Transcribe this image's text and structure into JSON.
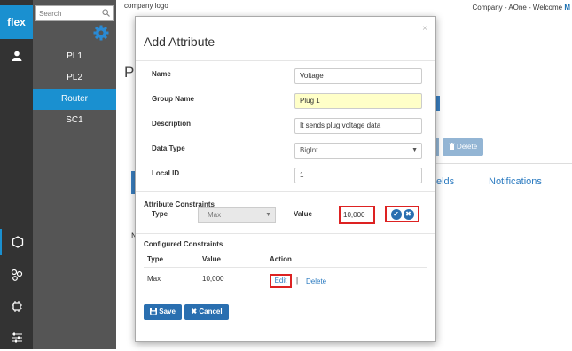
{
  "rail": {
    "logo": "flex"
  },
  "sidebar": {
    "search_placeholder": "Search",
    "items": [
      {
        "label": "PL1"
      },
      {
        "label": "PL2"
      },
      {
        "label": "Router"
      },
      {
        "label": "SC1"
      }
    ]
  },
  "header": {
    "company_logo": "company logo",
    "welcome_text": "Company - AOne - Welcome ",
    "welcome_user_initial": "M"
  },
  "background": {
    "page_title_initial": "P",
    "delete_label": "Delete",
    "tab_fields_partial": "elds",
    "tab_notifications": "Notifications",
    "n_partial": "N"
  },
  "modal": {
    "title": "Add Attribute",
    "close": "×",
    "fields": {
      "name_label": "Name",
      "name_value": "Voltage",
      "group_label": "Group Name",
      "group_value": "Plug 1",
      "description_label": "Description",
      "description_value": "It sends plug voltage data",
      "data_type_label": "Data Type",
      "data_type_value": "BigInt",
      "local_id_label": "Local ID",
      "local_id_value": "1"
    },
    "constraints": {
      "title": "Attribute Constraints",
      "type_label": "Type",
      "type_value": "Max",
      "value_label": "Value",
      "value_value": "10,000"
    },
    "configured": {
      "title": "Configured Constraints",
      "headers": [
        "Type",
        "Value",
        "Action"
      ],
      "rows": [
        {
          "type": "Max",
          "value": "10,000",
          "edit": "Edit",
          "sep": "|",
          "delete": "Delete"
        }
      ]
    },
    "save_label": "Save",
    "cancel_label": "Cancel"
  },
  "colors": {
    "accent": "#1a90d0",
    "button": "#2a6fb0",
    "highlight": "#dd2222",
    "group_bg": "#ffffc8"
  }
}
